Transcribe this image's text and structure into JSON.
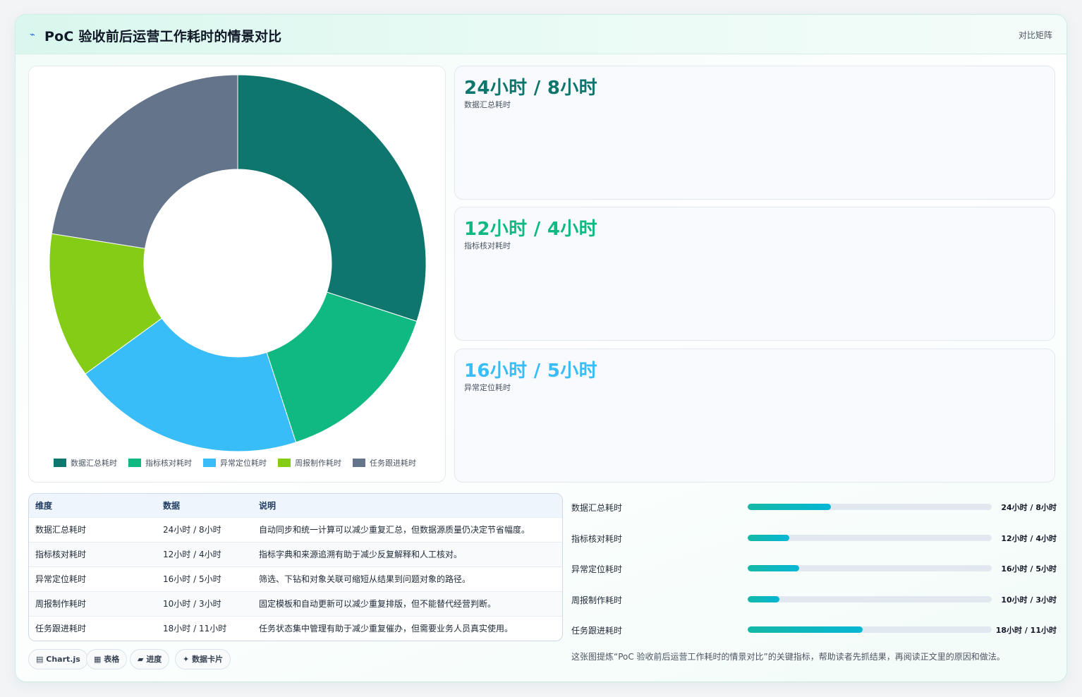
{
  "header": {
    "title": "PoC 验收前后运营工作耗时的情景对比",
    "mode_label": "对比矩阵"
  },
  "colors": {
    "teal_dark": "#0f766e",
    "green": "#10b981",
    "sky": "#38bdf8",
    "lime": "#84cc16",
    "slate": "#64748b"
  },
  "chart_data": {
    "type": "pie",
    "subtype": "doughnut",
    "legend_position": "bottom",
    "categories": [
      "数据汇总耗时",
      "指标核对耗时",
      "异常定位耗时",
      "周报制作耗时",
      "任务跟进耗时"
    ],
    "values": [
      24,
      12,
      16,
      10,
      18
    ],
    "colors": [
      "#0f766e",
      "#10b981",
      "#38bdf8",
      "#84cc16",
      "#64748b"
    ]
  },
  "kpis": [
    {
      "value": "24小时 / 8小时",
      "label": "数据汇总耗时",
      "color": "#0f766e"
    },
    {
      "value": "12小时 / 4小时",
      "label": "指标核对耗时",
      "color": "#10b981"
    },
    {
      "value": "16小时 / 5小时",
      "label": "异常定位耗时",
      "color": "#38bdf8"
    }
  ],
  "table": {
    "headers": [
      "维度",
      "数据",
      "说明"
    ],
    "rows": [
      [
        "数据汇总耗时",
        "24小时 / 8小时",
        "自动同步和统一计算可以减少重复汇总，但数据源质量仍决定节省幅度。"
      ],
      [
        "指标核对耗时",
        "12小时 / 4小时",
        "指标字典和来源追溯有助于减少反复解释和人工核对。"
      ],
      [
        "异常定位耗时",
        "16小时 / 5小时",
        "筛选、下钻和对象关联可缩短从结果到问题对象的路径。"
      ],
      [
        "周报制作耗时",
        "10小时 / 3小时",
        "固定模板和自动更新可以减少重复排版，但不能替代经营判断。"
      ],
      [
        "任务跟进耗时",
        "18小时 / 11小时",
        "任务状态集中管理有助于减少重复催办，但需要业务人员真实使用。"
      ]
    ]
  },
  "progress": [
    {
      "label": "数据汇总耗时",
      "value": "24小时 / 8小时",
      "fill": 0.34
    },
    {
      "label": "指标核对耗时",
      "value": "12小时 / 4小时",
      "fill": 0.17
    },
    {
      "label": "异常定位耗时",
      "value": "16小时 / 5小时",
      "fill": 0.21
    },
    {
      "label": "周报制作耗时",
      "value": "10小时 / 3小时",
      "fill": 0.13
    },
    {
      "label": "任务跟进耗时",
      "value": "18小时 / 11小时",
      "fill": 0.47
    }
  ],
  "chips": [
    {
      "icon": "▤",
      "label": "Chart.js"
    },
    {
      "icon": "▦",
      "label": "表格"
    },
    {
      "icon": "▰",
      "label": "进度"
    },
    {
      "icon": "✦",
      "label": "数据卡片"
    }
  ],
  "summary": "这张图提炼“PoC 验收前后运营工作耗时的情景对比”的关键指标，帮助读者先抓结果，再阅读正文里的原因和做法。"
}
